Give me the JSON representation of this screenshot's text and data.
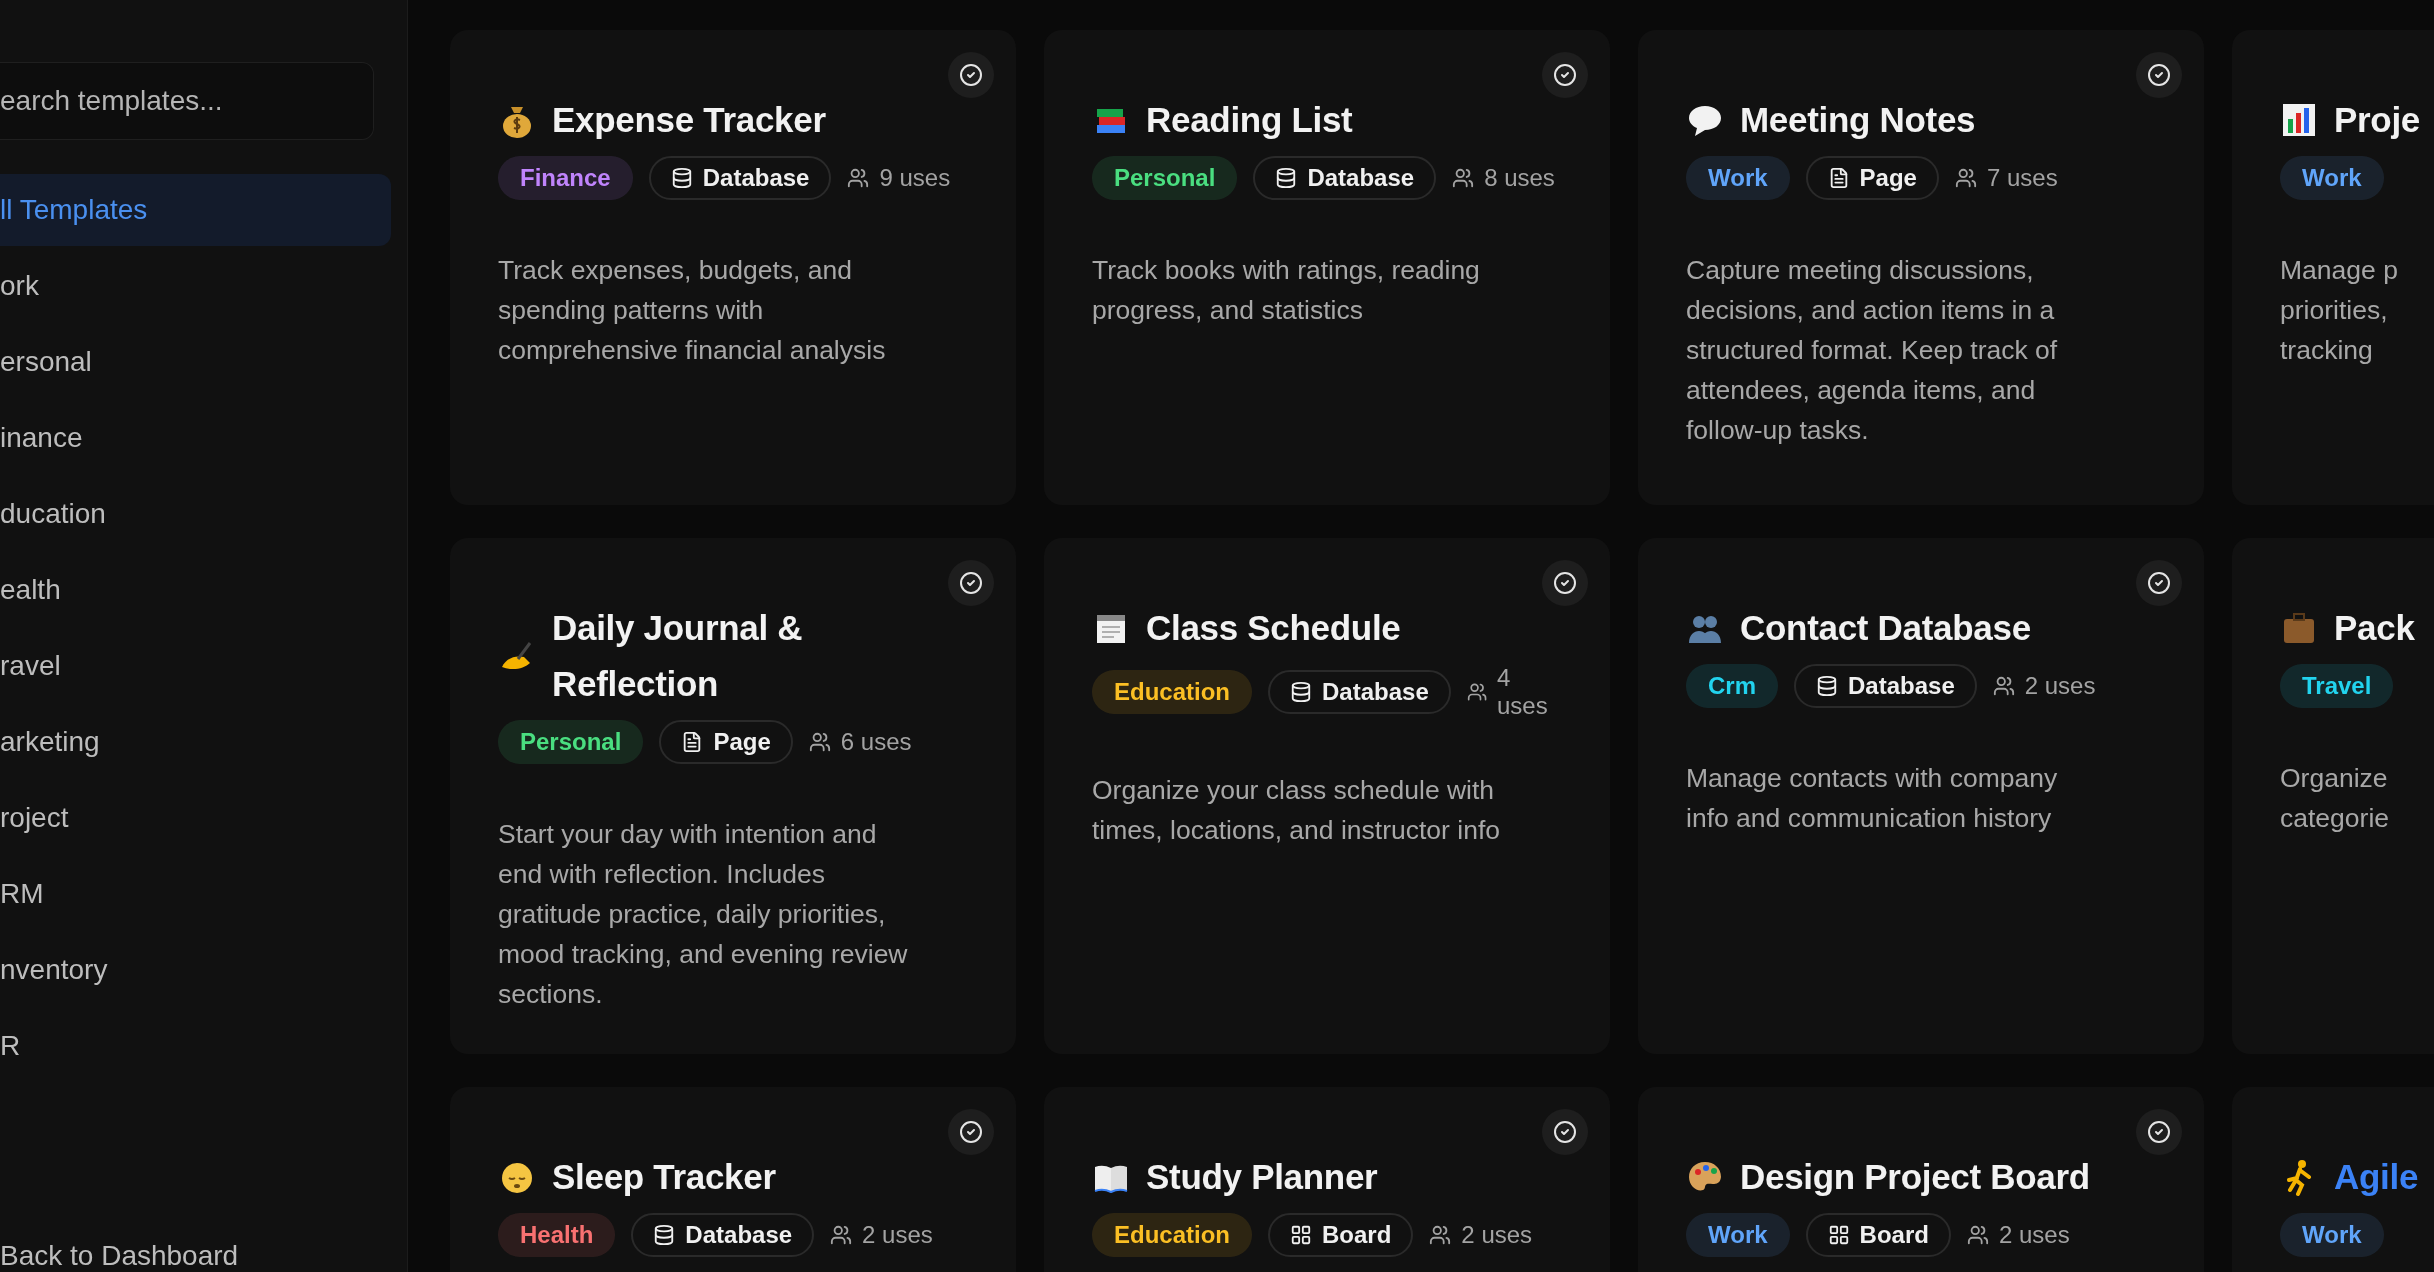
{
  "sidebar": {
    "search": {
      "placeholder": "earch templates..."
    },
    "items": [
      {
        "label": "ll Templates",
        "selected": true
      },
      {
        "label": "ork",
        "selected": false
      },
      {
        "label": "ersonal",
        "selected": false
      },
      {
        "label": "inance",
        "selected": false
      },
      {
        "label": "ducation",
        "selected": false
      },
      {
        "label": "ealth",
        "selected": false
      },
      {
        "label": "ravel",
        "selected": false
      },
      {
        "label": "arketing",
        "selected": false
      },
      {
        "label": "roject",
        "selected": false
      },
      {
        "label": "RM",
        "selected": false
      },
      {
        "label": "nventory",
        "selected": false
      },
      {
        "label": "R",
        "selected": false
      }
    ],
    "back_link": "Back to Dashboard"
  },
  "cards": [
    {
      "title": "Expense Tracker",
      "highlighted": false,
      "category": {
        "label": "Finance",
        "color": "#c084fc"
      },
      "type": {
        "kind": "database",
        "label": "Database"
      },
      "uses": "9 uses",
      "description_lines": [
        "Track expenses, budgets, and",
        "spending patterns with",
        "comprehensive financial analysis"
      ]
    },
    {
      "title": "Reading List",
      "highlighted": false,
      "category": {
        "label": "Personal",
        "color": "#4ade80"
      },
      "type": {
        "kind": "database",
        "label": "Database"
      },
      "uses": "8 uses",
      "description_lines": [
        "Track books with ratings, reading",
        "progress, and statistics"
      ]
    },
    {
      "title": "Meeting Notes",
      "highlighted": false,
      "category": {
        "label": "Work",
        "color": "#60a5fa"
      },
      "type": {
        "kind": "page",
        "label": "Page"
      },
      "uses": "7 uses",
      "description_lines": [
        "Capture meeting discussions,",
        "decisions, and action items in a",
        "structured format. Keep track of",
        "attendees, agenda items, and",
        "follow-up tasks."
      ]
    },
    {
      "title": "Proje",
      "highlighted": false,
      "category": {
        "label": "Work",
        "color": "#60a5fa"
      },
      "description_lines": [
        "Manage p",
        "priorities,",
        "tracking"
      ]
    },
    {
      "title": "Daily Journal & Reflection",
      "highlighted": false,
      "category": {
        "label": "Personal",
        "color": "#4ade80"
      },
      "type": {
        "kind": "page",
        "label": "Page"
      },
      "uses": "6 uses",
      "description_lines": [
        "Start your day with intention and",
        "end with reflection. Includes",
        "gratitude practice, daily priorities,",
        "mood tracking, and evening review",
        "sections."
      ]
    },
    {
      "title": "Class Schedule",
      "highlighted": false,
      "category": {
        "label": "Education",
        "color": "#fbbf24"
      },
      "type": {
        "kind": "database",
        "label": "Database"
      },
      "uses": "4 uses",
      "description_lines": [
        "Organize your class schedule with",
        "times, locations, and instructor info"
      ]
    },
    {
      "title": "Contact Database",
      "highlighted": false,
      "category": {
        "label": "Crm",
        "color": "#22d3ee"
      },
      "type": {
        "kind": "database",
        "label": "Database"
      },
      "uses": "2 uses",
      "description_lines": [
        "Manage contacts with company",
        "info and communication history"
      ]
    },
    {
      "title": "Pack",
      "highlighted": false,
      "category": {
        "label": "Travel",
        "color": "#22d3ee"
      },
      "description_lines": [
        "Organize",
        "categorie"
      ]
    },
    {
      "title": "Sleep Tracker",
      "highlighted": false,
      "category": {
        "label": "Health",
        "color": "#f87171"
      },
      "type": {
        "kind": "database",
        "label": "Database"
      },
      "uses": "2 uses"
    },
    {
      "title": "Study Planner",
      "highlighted": false,
      "category": {
        "label": "Education",
        "color": "#fbbf24"
      },
      "type": {
        "kind": "board",
        "label": "Board"
      },
      "uses": "2 uses"
    },
    {
      "title": "Design Project Board",
      "highlighted": false,
      "category": {
        "label": "Work",
        "color": "#60a5fa"
      },
      "type": {
        "kind": "board",
        "label": "Board"
      },
      "uses": "2 uses"
    },
    {
      "title": "Agile",
      "highlighted": true,
      "category": {
        "label": "Work",
        "color": "#60a5fa"
      }
    }
  ]
}
